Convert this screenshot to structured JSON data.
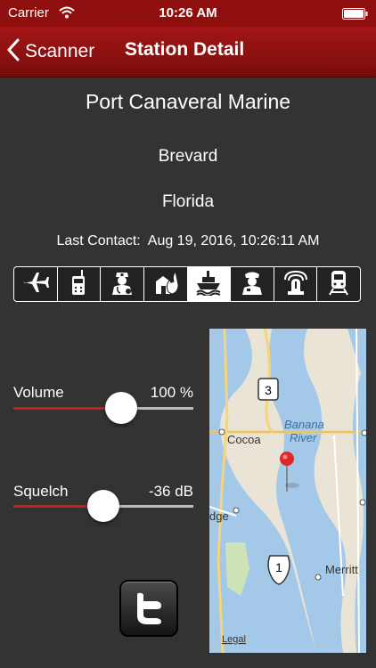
{
  "status_bar": {
    "carrier": "Carrier",
    "time": "10:26 AM"
  },
  "nav": {
    "back_label": "Scanner",
    "title": "Station Detail"
  },
  "station": {
    "name": "Port Canaveral Marine",
    "county": "Brevard",
    "state": "Florida",
    "last_contact_label": "Last Contact:",
    "last_contact_value": "Aug 19, 2016, 10:26:11 AM"
  },
  "categories": [
    {
      "icon": "airplane-icon",
      "selected": false
    },
    {
      "icon": "radio-icon",
      "selected": false
    },
    {
      "icon": "doctor-icon",
      "selected": false
    },
    {
      "icon": "fire-icon",
      "selected": false
    },
    {
      "icon": "ship-icon",
      "selected": true
    },
    {
      "icon": "police-officer-icon",
      "selected": false
    },
    {
      "icon": "emergency-beacon-icon",
      "selected": false
    },
    {
      "icon": "train-icon",
      "selected": false
    }
  ],
  "volume": {
    "label": "Volume",
    "value_text": "100 %",
    "level": 0.6
  },
  "squelch": {
    "label": "Squelch",
    "value_text": "-36 dB",
    "level": 0.5
  },
  "map": {
    "labels": {
      "cocoa": "Cocoa",
      "river_line1": "Banana",
      "river_line2": "River",
      "edge": "dge",
      "merritt": "Merritt",
      "legal": "Legal"
    },
    "shields": {
      "sr3": "3",
      "us1": "1"
    }
  },
  "colors": {
    "accent_red": "#cc1c1c",
    "navbar": "#8f0f0f",
    "background": "#333333"
  }
}
